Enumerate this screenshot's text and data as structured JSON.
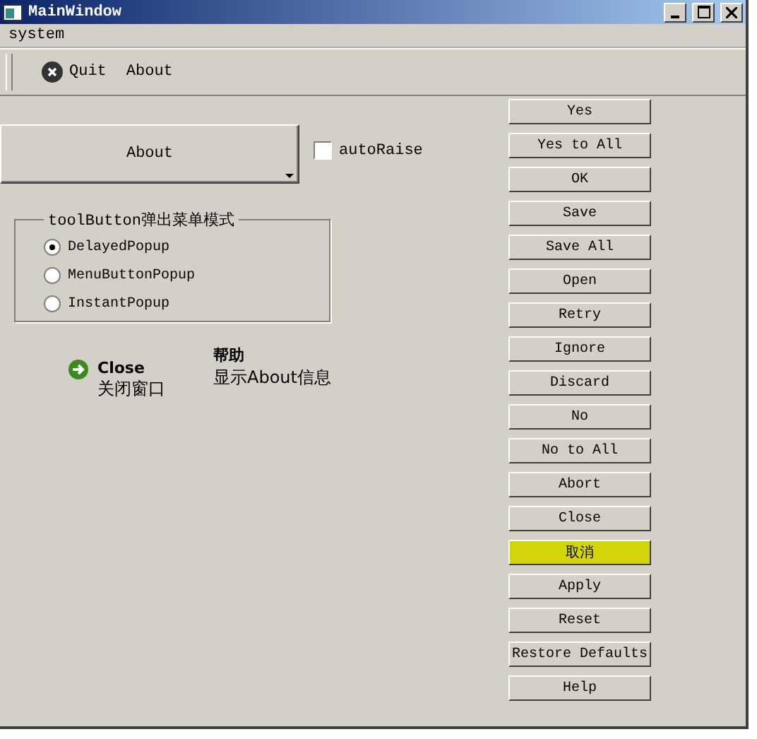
{
  "window": {
    "title": "MainWindow"
  },
  "menu": [
    "system"
  ],
  "toolbar": [
    {
      "label": "Quit",
      "kind": "icon"
    },
    {
      "label": "About",
      "kind": "text"
    }
  ],
  "tool_button": {
    "label": "About"
  },
  "auto_raise": {
    "label": "autoRaise",
    "checked": false
  },
  "popup_mode": {
    "title": "toolButton弹出菜单模式",
    "options": [
      {
        "label": "DelayedPopup",
        "selected": true
      },
      {
        "label": "MenuButtonPopup",
        "selected": false
      },
      {
        "label": "InstantPopup",
        "selected": false
      }
    ]
  },
  "command_links": [
    {
      "title": "Close",
      "description": "关闭窗口",
      "kind": "icon"
    },
    {
      "title": "帮助",
      "description": "显示About信息",
      "kind": "plain"
    }
  ],
  "buttons": [
    {
      "label": "Yes",
      "highlighted": false
    },
    {
      "label": "Yes to All",
      "highlighted": false
    },
    {
      "label": "OK",
      "highlighted": false
    },
    {
      "label": "Save",
      "highlighted": false
    },
    {
      "label": "Save All",
      "highlighted": false
    },
    {
      "label": "Open",
      "highlighted": false
    },
    {
      "label": "Retry",
      "highlighted": false
    },
    {
      "label": "Ignore",
      "highlighted": false
    },
    {
      "label": "Discard",
      "highlighted": false
    },
    {
      "label": "No",
      "highlighted": false
    },
    {
      "label": "No to All",
      "highlighted": false
    },
    {
      "label": "Abort",
      "highlighted": false
    },
    {
      "label": "Close",
      "highlighted": false
    },
    {
      "label": "取消",
      "highlighted": true
    },
    {
      "label": "Apply",
      "highlighted": false
    },
    {
      "label": "Reset",
      "highlighted": false
    },
    {
      "label": "Restore Defaults",
      "highlighted": false
    },
    {
      "label": "Help",
      "highlighted": false
    }
  ]
}
